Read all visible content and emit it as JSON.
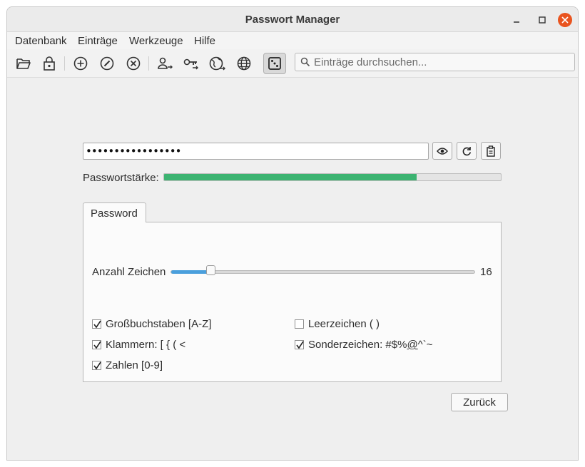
{
  "window": {
    "title": "Passwort Manager"
  },
  "menu": [
    "Datenbank",
    "Einträge",
    "Werkzeuge",
    "Hilfe"
  ],
  "toolbar": {
    "icons": [
      "folder-open-icon",
      "lock-icon",
      "add-entry-icon",
      "edit-entry-icon",
      "delete-entry-icon",
      "user-to-clipboard-icon",
      "key-to-clipboard-icon",
      "globe-open-icon",
      "globe-icon",
      "dice-icon"
    ],
    "search_placeholder": "Einträge durchsuchen..."
  },
  "password": {
    "masked_value": "•••••••••••••••••"
  },
  "strength": {
    "label": "Passwortstärke:",
    "fraction": 0.75,
    "color": "#3cb371"
  },
  "tabs": [
    "Password"
  ],
  "length": {
    "label": "Anzahl Zeichen",
    "value": "16",
    "slider_fraction": 0.13
  },
  "options": {
    "uppercase": {
      "label": "Großbuchstaben [A-Z]",
      "checked": true
    },
    "brackets": {
      "label": "Klammern: [ { ( <",
      "checked": true
    },
    "digits": {
      "label": "Zahlen [0-9]",
      "checked": true
    },
    "spaces": {
      "label": "Leerzeichen ( )",
      "checked": false
    },
    "special": {
      "label_pre": "Sonderzeichen: #$%",
      "label_ul": "@",
      "label_post": "^`~",
      "checked": true
    }
  },
  "buttons": {
    "back": "Zurück"
  },
  "colors": {
    "accent": "#4a9fdc",
    "close": "#e9541f"
  }
}
